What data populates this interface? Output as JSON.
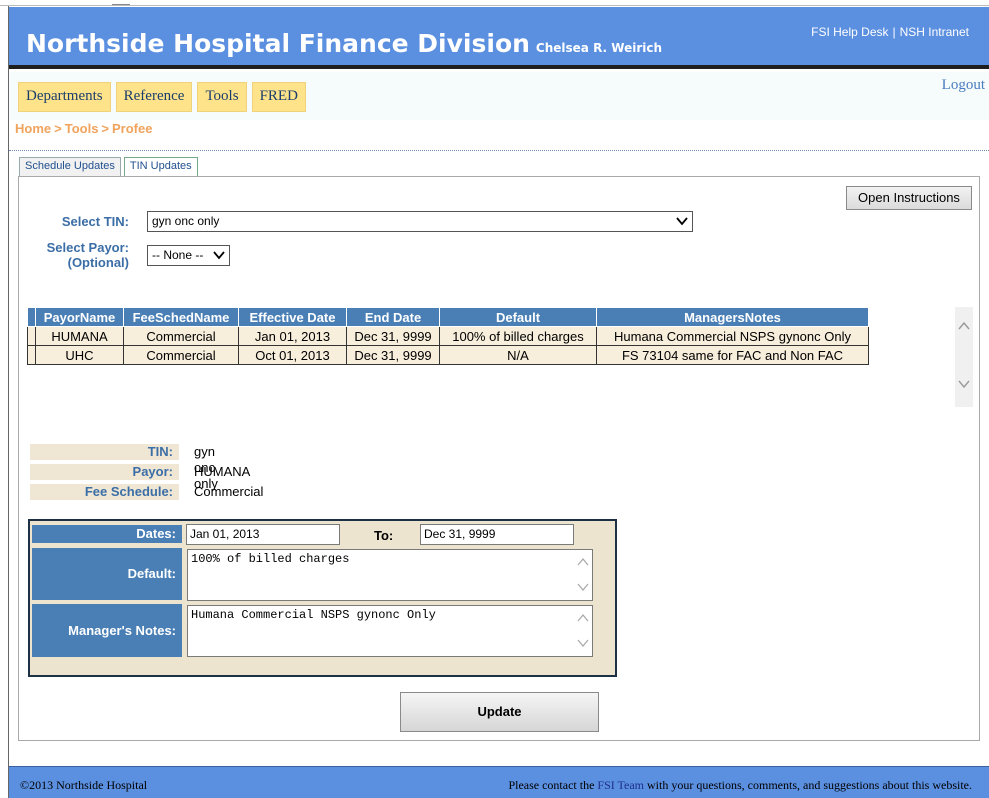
{
  "header": {
    "title": "Northside Hospital Finance Division",
    "user": "Chelsea R. Weirich",
    "links": [
      "FSI Help Desk",
      "NSH Intranet"
    ],
    "link_separator": "|"
  },
  "nav": {
    "menu": [
      "Departments",
      "Reference",
      "Tools",
      "FRED"
    ],
    "logout": "Logout"
  },
  "breadcrumb": [
    "Home",
    "Tools",
    "Profee"
  ],
  "breadcrumb_separator": ">",
  "tabs": [
    {
      "label": "Schedule Updates",
      "active": false
    },
    {
      "label": "TIN Updates",
      "active": true
    }
  ],
  "form": {
    "open_instructions": "Open Instructions",
    "select_tin_label": "Select TIN:",
    "select_tin_value": "gyn onc only",
    "select_payor_label": "Select Payor:",
    "select_payor_optional": "(Optional)",
    "select_payor_value": "-- None --"
  },
  "grid": {
    "columns": [
      "PayorName",
      "FeeSchedName",
      "Effective Date",
      "End Date",
      "Default",
      "ManagersNotes"
    ],
    "rows": [
      [
        "HUMANA",
        "Commercial",
        "Jan 01, 2013",
        "Dec 31, 9999",
        "100% of billed charges",
        "Humana Commercial NSPS gynonc Only"
      ],
      [
        "UHC",
        "Commercial",
        "Oct 01, 2013",
        "Dec 31, 9999",
        "N/A",
        "FS 73104 same for FAC and Non FAC"
      ]
    ]
  },
  "details": {
    "tin_label": "TIN:",
    "tin_value": "gyn onc only",
    "payor_label": "Payor:",
    "payor_value": "HUMANA",
    "fee_label": "Fee Schedule:",
    "fee_value": "Commercial"
  },
  "edit": {
    "dates_label": "Dates:",
    "date_from": "Jan 01, 2013",
    "to_label": "To:",
    "date_to": "Dec 31, 9999",
    "default_label": "Default:",
    "default_value": "100% of billed charges",
    "notes_label": "Manager's Notes:",
    "notes_value": "Humana Commercial NSPS gynonc Only",
    "update_button": "Update"
  },
  "footer": {
    "copyright": "©2013 Northside Hospital",
    "contact_prefix": "Please contact the",
    "contact_link": "FSI Team",
    "contact_suffix": "with your questions, comments, and suggestions about this website."
  },
  "colors": {
    "header_blue": "#5b8fe0",
    "menu_yellow": "#ffe38a",
    "grid_header": "#4a7fb6",
    "grid_row": "#f7eedc",
    "breadcrumb": "#f0a35c"
  }
}
